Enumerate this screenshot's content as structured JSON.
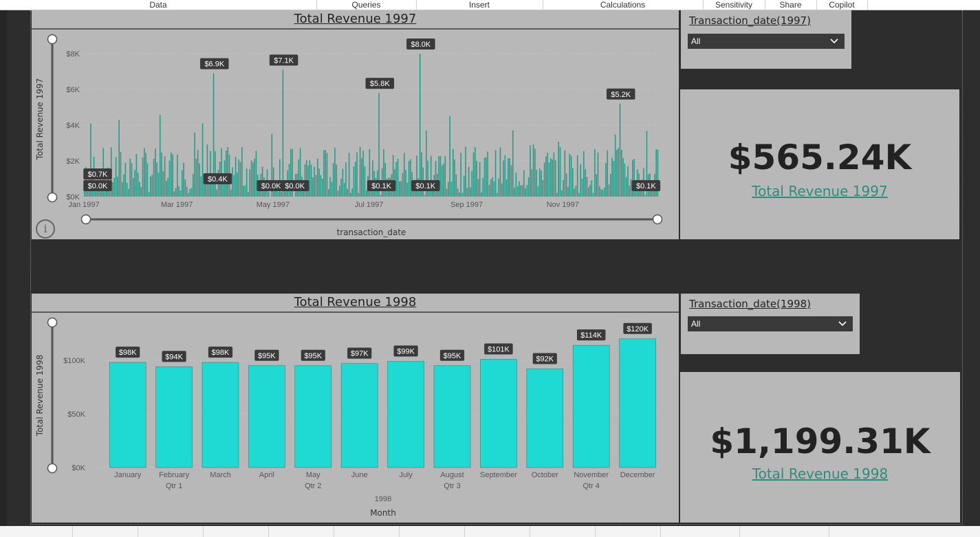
{
  "ribbon": {
    "tabs": [
      {
        "label": "Data"
      },
      {
        "label": "Queries"
      },
      {
        "label": "Insert"
      },
      {
        "label": "Calculations"
      },
      {
        "label": "Sensitivity"
      },
      {
        "label": "Share"
      },
      {
        "label": "Copilot"
      }
    ]
  },
  "chart1997": {
    "title": "Total Revenue 1997",
    "info_glyph": "i",
    "chart_data": {
      "type": "bar",
      "title": "Total Revenue 1997",
      "xlabel": "transaction_date",
      "ylabel": "Total Revenue 1997",
      "ylim": [
        0,
        8000
      ],
      "y_ticks": [
        "$0K",
        "$2K",
        "$4K",
        "$6K",
        "$8K"
      ],
      "x_ticks": [
        "Jan 1997",
        "Mar 1997",
        "May 1997",
        "Jul 1997",
        "Sep 1997",
        "Nov 1997"
      ],
      "annotations": [
        {
          "label": "$0.7K",
          "x": "1997-01-01",
          "value": 700
        },
        {
          "label": "$0.0K",
          "x": "1997-01-01",
          "value": 0
        },
        {
          "label": "$6.9K",
          "x": "1997-03-24",
          "value": 6900
        },
        {
          "label": "$0.4K",
          "x": "1997-03-26",
          "value": 400
        },
        {
          "label": "$0.0K",
          "x": "1997-04-29",
          "value": 0
        },
        {
          "label": "$7.1K",
          "x": "1997-05-07",
          "value": 7100
        },
        {
          "label": "$0.0K",
          "x": "1997-05-14",
          "value": 0
        },
        {
          "label": "$5.8K",
          "x": "1997-07-07",
          "value": 5800
        },
        {
          "label": "$0.1K",
          "x": "1997-07-08",
          "value": 100
        },
        {
          "label": "$8.0K",
          "x": "1997-08-02",
          "value": 8000
        },
        {
          "label": "$0.1K",
          "x": "1997-08-05",
          "value": 100
        },
        {
          "label": "$5.2K",
          "x": "1997-12-07",
          "value": 5200
        },
        {
          "label": "$0.1K",
          "x": "1997-12-23",
          "value": 100
        }
      ]
    }
  },
  "card1997": {
    "value": "$565.24K",
    "label": "Total Revenue 1997"
  },
  "slicer1997": {
    "title": "Transaction_date(1997)",
    "selected": "All"
  },
  "chart1998": {
    "title": "Total Revenue 1998",
    "chart_data": {
      "type": "bar",
      "title": "Total Revenue 1998",
      "xlabel": "Month",
      "ylabel": "Total Revenue 1998",
      "ylim": [
        0,
        120000
      ],
      "y_ticks": [
        "$0K",
        "$50K",
        "$100K"
      ],
      "year_label": "1998",
      "categories": [
        "January",
        "February",
        "March",
        "April",
        "May",
        "June",
        "July",
        "August",
        "September",
        "October",
        "November",
        "December"
      ],
      "quarters": [
        "",
        "Qtr 1",
        "",
        "",
        "Qtr 2",
        "",
        "",
        "Qtr 3",
        "",
        "",
        "Qtr 4",
        ""
      ],
      "values": [
        98000,
        94000,
        98000,
        95000,
        95000,
        97000,
        99000,
        95000,
        101000,
        92000,
        114000,
        120000
      ],
      "value_labels": [
        "$98K",
        "$94K",
        "$98K",
        "$95K",
        "$95K",
        "$97K",
        "$99K",
        "$95K",
        "$101K",
        "$92K",
        "$114K",
        "$120K"
      ],
      "color": "#1fdad3"
    }
  },
  "card1998": {
    "value": "$1,199.31K",
    "label": "Total Revenue 1998"
  },
  "slicer1998": {
    "title": "Transaction_date(1998)",
    "selected": "All"
  },
  "colors": {
    "bar1997": "#2a9a87",
    "bar1998": "#1fdad3",
    "label_bg": "#3a3a3a",
    "accent_text": "#2f8c7c"
  },
  "icons": {
    "dropdown": "chevron-down-icon",
    "info": "info-icon"
  }
}
